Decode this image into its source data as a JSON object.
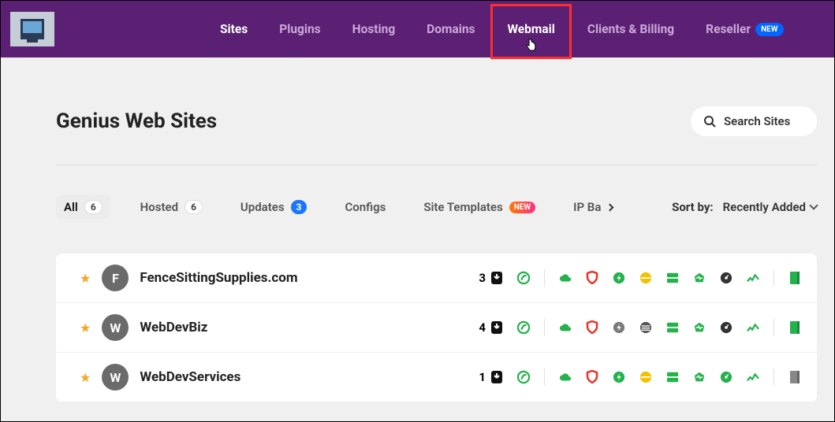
{
  "nav": {
    "items": [
      {
        "label": "Sites",
        "active": true
      },
      {
        "label": "Plugins"
      },
      {
        "label": "Hosting"
      },
      {
        "label": "Domains"
      },
      {
        "label": "Webmail",
        "highlight": true
      },
      {
        "label": "Clients & Billing"
      },
      {
        "label": "Reseller",
        "badge": "NEW"
      }
    ]
  },
  "page": {
    "title": "Genius Web Sites",
    "search_placeholder": "Search Sites"
  },
  "tabs": {
    "all": {
      "label": "All",
      "count": "6"
    },
    "hosted": {
      "label": "Hosted",
      "count": "6"
    },
    "updates": {
      "label": "Updates",
      "count": "3"
    },
    "configs": {
      "label": "Configs"
    },
    "templates": {
      "label": "Site Templates",
      "badge": "NEW"
    },
    "backups": {
      "label": "IP Ba"
    }
  },
  "sort": {
    "label": "Sort by:",
    "value": "Recently Added"
  },
  "sites": [
    {
      "avatar": "F",
      "name": "FenceSittingSupplies.com",
      "updates": "3"
    },
    {
      "avatar": "W",
      "name": "WebDevBiz",
      "updates": "4"
    },
    {
      "avatar": "W",
      "name": "WebDevServices",
      "updates": "1"
    }
  ],
  "icons": {
    "colors": {
      "green": "#24b24c",
      "red": "#e6332a",
      "yellow": "#f2c200",
      "grey": "#7a7a7a",
      "dark": "#333333",
      "pink": "#ff6ea8"
    }
  }
}
